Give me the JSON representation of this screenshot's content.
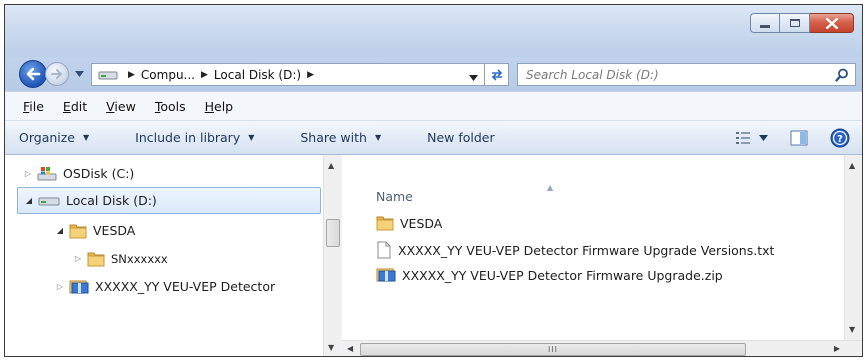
{
  "address": {
    "crumbs": [
      "Compu...",
      "Local Disk (D:)"
    ]
  },
  "search": {
    "placeholder": "Search Local Disk (D:)"
  },
  "menu": [
    {
      "label": "File",
      "u": "F",
      "rest": "ile"
    },
    {
      "label": "Edit",
      "u": "E",
      "rest": "dit"
    },
    {
      "label": "View",
      "u": "V",
      "rest": "iew"
    },
    {
      "label": "Tools",
      "u": "T",
      "rest": "ools"
    },
    {
      "label": "Help",
      "u": "H",
      "rest": "elp"
    }
  ],
  "toolbar": {
    "organize": "Organize",
    "include": "Include in library",
    "share": "Share with",
    "newfolder": "New folder"
  },
  "tree": [
    {
      "label": "OSDisk (C:)",
      "icon": "os-drive-icon"
    },
    {
      "label": "Local Disk (D:)",
      "icon": "drive-icon",
      "selected": true
    },
    {
      "label": "VESDA",
      "icon": "folder-icon"
    },
    {
      "label": "SNxxxxxx",
      "icon": "folder-icon"
    },
    {
      "label": "XXXXX_YY VEU-VEP Detector",
      "icon": "zip-folder-icon"
    }
  ],
  "files": {
    "column_name": "Name",
    "items": [
      {
        "name": "VESDA",
        "icon": "folder-icon"
      },
      {
        "name": "XXXXX_YY VEU-VEP Detector Firmware Upgrade Versions.txt",
        "icon": "text-file-icon"
      },
      {
        "name": "XXXXX_YY VEU-VEP Detector Firmware Upgrade.zip",
        "icon": "zip-file-icon"
      }
    ]
  },
  "colors": {
    "accent": "#2d6bc4",
    "close_red": "#c4432c",
    "folder": "#e8b64a"
  }
}
